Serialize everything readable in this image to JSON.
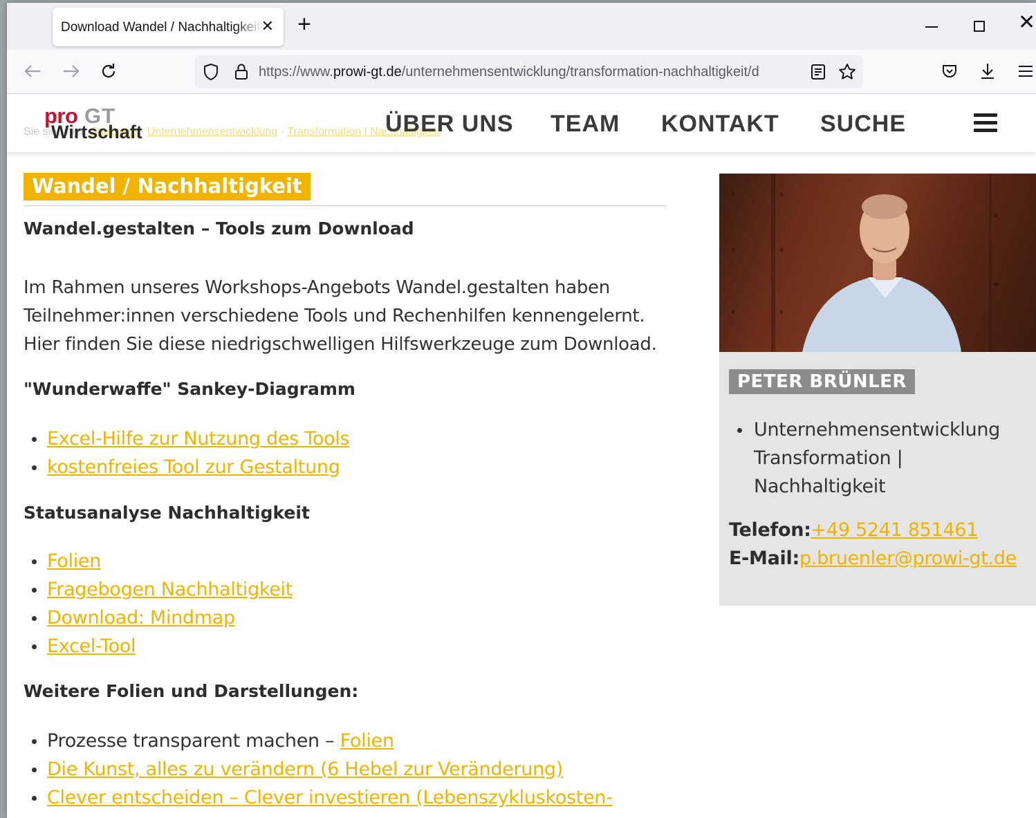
{
  "browser": {
    "tab_title": "Download Wandel / Nachhaltigkeit",
    "url_prefix": "https://www.",
    "url_host": "prowi-gt.de",
    "url_path": "/unternehmensentwicklung/transformation-nachhaltigkeit/d"
  },
  "site": {
    "logo": {
      "pro": "pro",
      "gt": "GT",
      "wirtschaft": "Wirtschaft"
    },
    "breadcrumb": {
      "prefix": "Sie sind hier:",
      "items": [
        "Startseite",
        "Unternehmensentwicklung",
        "Transformation | Nachhaltigkeit"
      ]
    },
    "nav": [
      "ÜBER UNS",
      "TEAM",
      "KONTAKT",
      "SUCHE"
    ]
  },
  "main": {
    "title": "Wandel / Nachhaltigkeit",
    "subtitle": "Wandel.gestalten – Tools zum Download",
    "intro": "Im Rahmen unseres Workshops-Angebots Wandel.gestalten haben Teilnehmer:innen verschiedene Tools und Rechenhilfen kennengelernt. Hier finden Sie diese niedrigschwelligen Hilfswerkzeuge zum Download.",
    "sections": [
      {
        "heading": "\"Wunderwaffe\" Sankey-Diagramm",
        "links": [
          "Excel-Hilfe zur Nutzung des Tools",
          "kostenfreies Tool zur Gestaltung"
        ]
      },
      {
        "heading": "Statusanalyse Nachhaltigkeit",
        "links": [
          "Folien",
          "Fragebogen Nachhaltigkeit",
          "Download: Mindmap",
          "Excel-Tool"
        ]
      },
      {
        "heading": "Weitere Folien und Darstellungen:",
        "items": [
          {
            "text": "Prozesse transparent machen – ",
            "link": "Folien"
          },
          {
            "text": "",
            "link": "Die Kunst, alles zu verändern (6 Hebel zur Veränderung)"
          },
          {
            "text": "",
            "link": "Clever entscheiden – Clever investieren (Lebenszykluskosten-"
          }
        ]
      }
    ]
  },
  "sidebar": {
    "name": "PETER BRÜNLER",
    "areas": [
      "Unternehmensentwicklung Transformation | Nachhaltigkeit"
    ],
    "phone_label": "Telefon:",
    "phone": "+49 5241 851461",
    "email_label": "E-Mail:",
    "email": "p.bruenler@prowi-gt.de"
  },
  "colors": {
    "accent": "#f0b400",
    "logo_red": "#c4122f",
    "name_badge": "#8c8c8c",
    "card_bg": "#e5e5e5"
  }
}
